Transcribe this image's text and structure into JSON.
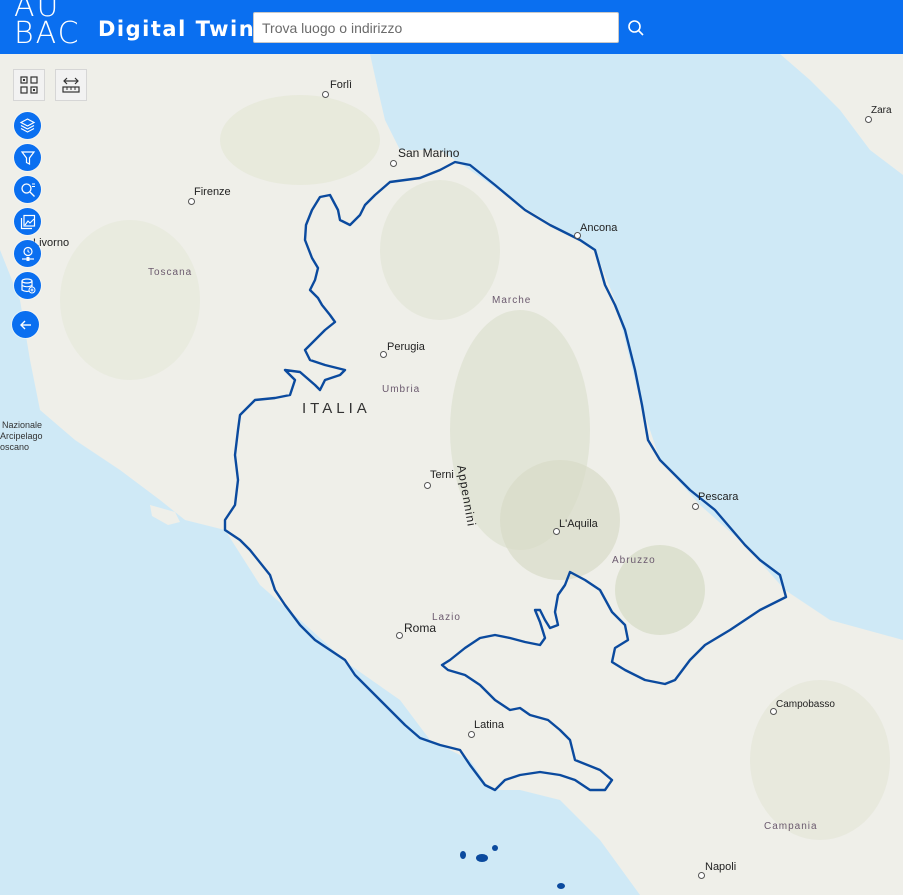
{
  "header": {
    "logo_line1": "AU",
    "logo_line2": "BAC",
    "app_title": "Digital Twin",
    "search_placeholder": "Trova luogo o indirizzo",
    "search_value": ""
  },
  "toolbar": {
    "tools": [
      "qr-grid-icon",
      "measure-ruler-icon"
    ],
    "actions": [
      "layers-icon",
      "filter-icon",
      "search-zoom-icon",
      "image-gallery-icon",
      "time-slider-icon",
      "database-add-icon",
      "back-arrow-icon"
    ]
  },
  "map": {
    "country": "ITALIA",
    "cities": {
      "forli": "Forlì",
      "san_marino": "San Marino",
      "firenze": "Firenze",
      "livorno": "Livorno",
      "ancona": "Ancona",
      "perugia": "Perugia",
      "terni": "Terni",
      "pescara": "Pescara",
      "l_aquila": "L'Aquila",
      "roma": "Roma",
      "latina": "Latina",
      "campobasso": "Campobasso",
      "napoli": "Napoli",
      "zara": "Zara"
    },
    "regions": {
      "toscana": "Toscana",
      "marche": "Marche",
      "umbria": "Umbria",
      "abruzzo": "Abruzzo",
      "lazio": "Lazio",
      "campania": "Campania"
    },
    "mountains": "Appennini",
    "park_line1": "Nazionale",
    "park_line2": "Arcipelago",
    "park_line3": "oscano"
  },
  "colors": {
    "header": "#0a6ff0",
    "sea": "#cfe9f6",
    "land": "#eeeee8",
    "boundary": "#0b4a9e"
  }
}
